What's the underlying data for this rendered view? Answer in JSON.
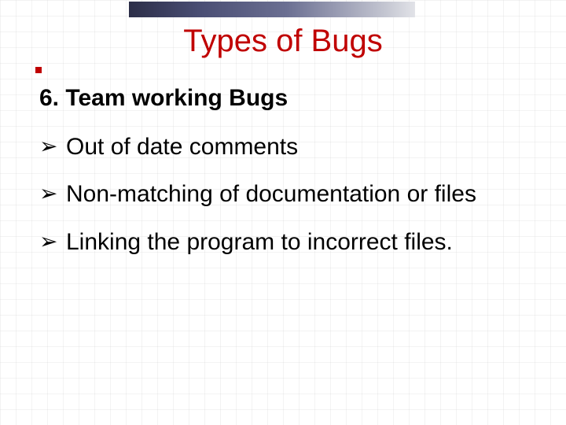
{
  "slide": {
    "title": "Types of Bugs",
    "section_heading": "6. Team working Bugs",
    "bullets": [
      "Out of date comments",
      "Non-matching of documentation or files",
      "Linking the program to incorrect files."
    ]
  }
}
